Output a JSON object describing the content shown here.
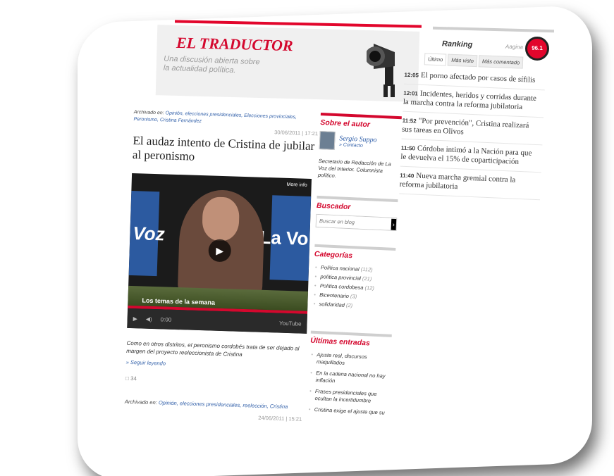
{
  "header": {
    "title": "EL TRADUCTOR",
    "subtitle": "Una discusión abierta sobre la actualidad política."
  },
  "ranking": {
    "title": "Ranking",
    "aux": "Aagina",
    "radio_logo": "96.1",
    "tabs": [
      "Último",
      "Más visto",
      "Más comentado"
    ],
    "items": [
      {
        "time": "12:05",
        "text": "El porno afectado por casos de sífilis"
      },
      {
        "time": "12:01",
        "text": "Incidentes, heridos y corridas durante la marcha contra la reforma jubilatoria"
      },
      {
        "time": "11:52",
        "text": "\"Por prevención\", Cristina realizará sus tareas en Olivos"
      },
      {
        "time": "11:50",
        "text": "Córdoba intimó a la Nación para que le devuelva el 15% de coparticipación"
      },
      {
        "time": "11:40",
        "text": "Nueva marcha gremial contra la reforma jubilatoria"
      }
    ]
  },
  "article": {
    "archived_label": "Archivado en:",
    "archived_tags": "Opinión, elecciones presidenciales, Elecciones provinciales, Peronismo, Cristina Fernández",
    "date": "30/06/2011 | 17:21",
    "headline": "El audaz intento de Cristina de jubilar al peronismo",
    "video": {
      "more_info": "More info",
      "brand_left": "Voz",
      "brand_right": "La Vo",
      "lower_third": "Los temas de la semana",
      "time": "0:00",
      "youtube": "YouTube"
    },
    "excerpt": "Como en otros distritos, el peronismo cordobés trata de ser dejado al margen del proyecto reeleccionista de Cristina",
    "read_more": "» Seguir leyendo",
    "comments": "34",
    "archived2_label": "Archivado en:",
    "archived2_tags": "Opinión, elecciones presidenciales, reelección, Cristina",
    "date2": "24/06/2011 | 15:21"
  },
  "sidebar": {
    "author_title": "Sobre el autor",
    "author_name": "Sergio Suppo",
    "contact": "» Contacto",
    "bio": "Secretario de Redacción de La Voz del Interior. Columnista político.",
    "search_title": "Buscador",
    "search_placeholder": "Buscar en blog",
    "categories_title": "Categorías",
    "categories": [
      {
        "name": "Política nacional",
        "count": "(112)"
      },
      {
        "name": "política provincial",
        "count": "(21)"
      },
      {
        "name": "Política cordobesa",
        "count": "(12)"
      },
      {
        "name": "Bicentenario",
        "count": "(3)"
      },
      {
        "name": "solidaridad",
        "count": "(2)"
      }
    ],
    "entries_title": "Últimas entradas",
    "entries": [
      "Ajuste real, discursos maquillados",
      "En la cadena nacional no hay inflación",
      "Frases presidenciales que ocultan la incertidumbre",
      "Cristina exige el ajuste que su"
    ]
  },
  "colors": {
    "accent": "#d4082e",
    "link": "#2f5ea8"
  }
}
